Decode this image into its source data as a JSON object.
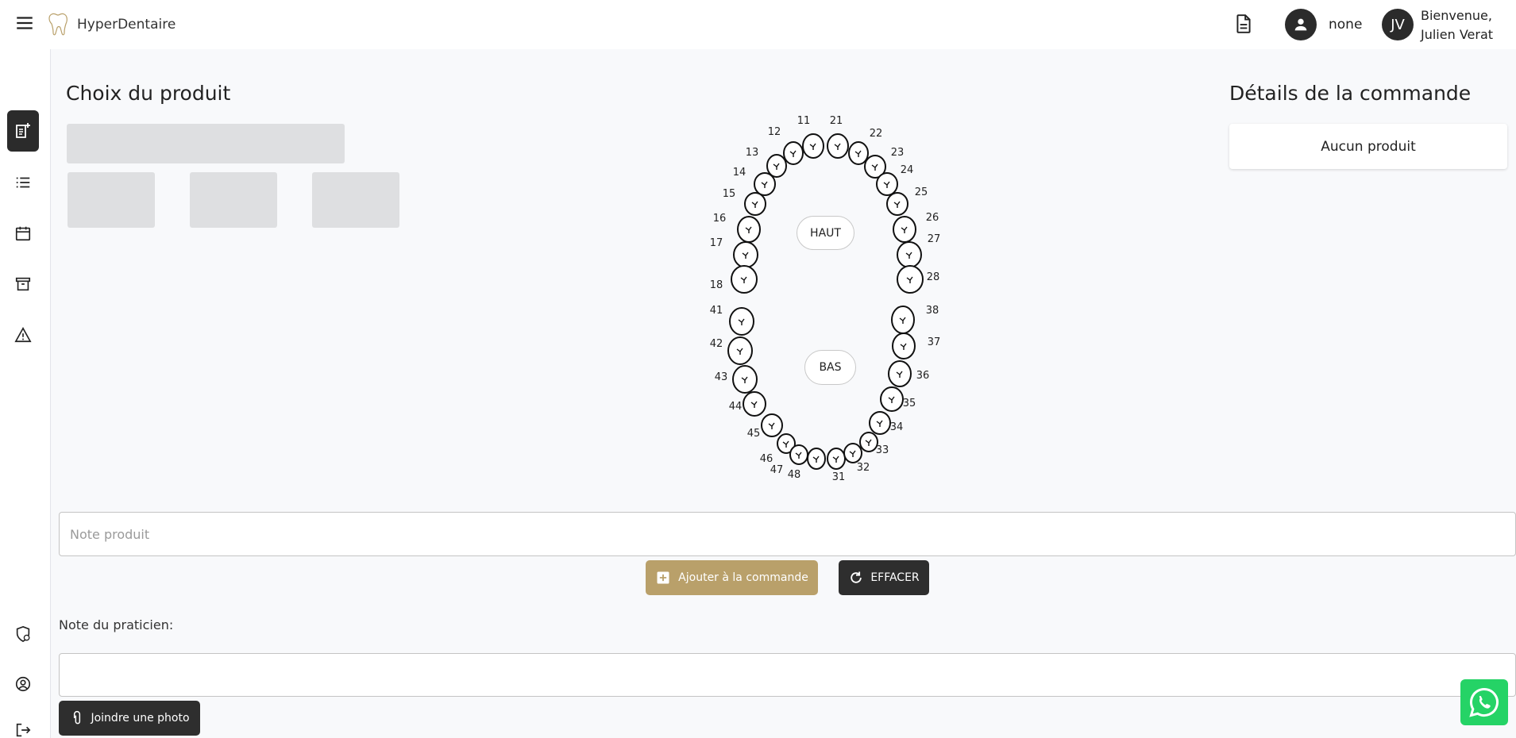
{
  "header": {
    "brand": "HyperDentaire",
    "user_label": "none",
    "avatar_initials": "JV",
    "welcome_line1": "Bienvenue,",
    "welcome_line2": "Julien Verat"
  },
  "sidebar": {
    "items": [
      {
        "icon": "new-order-icon",
        "active": true
      },
      {
        "icon": "list-icon"
      },
      {
        "icon": "calendar-icon"
      },
      {
        "icon": "archive-icon"
      },
      {
        "icon": "warning-icon"
      },
      {
        "icon": "shield-icon"
      },
      {
        "icon": "account-icon"
      },
      {
        "icon": "logout-icon"
      }
    ]
  },
  "main": {
    "product_title": "Choix du produit",
    "order_title": "Détails de la commande",
    "order_empty": "Aucun produit"
  },
  "teeth": {
    "upper_right": [
      "11",
      "12",
      "13",
      "14",
      "15",
      "16",
      "17",
      "18"
    ],
    "upper_left": [
      "21",
      "22",
      "23",
      "24",
      "25",
      "26",
      "27",
      "28"
    ],
    "lower_left": [
      "31",
      "32",
      "33",
      "34",
      "35",
      "36",
      "37",
      "38"
    ],
    "lower_right": [
      "41",
      "42",
      "43",
      "44",
      "45",
      "46",
      "47",
      "48"
    ],
    "haut_label": "HAUT",
    "bas_label": "BAS"
  },
  "form": {
    "note_placeholder": "Note produit",
    "add_label": "Ajouter à la commande",
    "clear_label": "EFFACER",
    "practitioner_label": "Note du praticien:",
    "photo_label": "Joindre une photo"
  },
  "colors": {
    "accent": "#b9a06a",
    "dark": "#2e2e2e",
    "whatsapp": "#25d366"
  }
}
